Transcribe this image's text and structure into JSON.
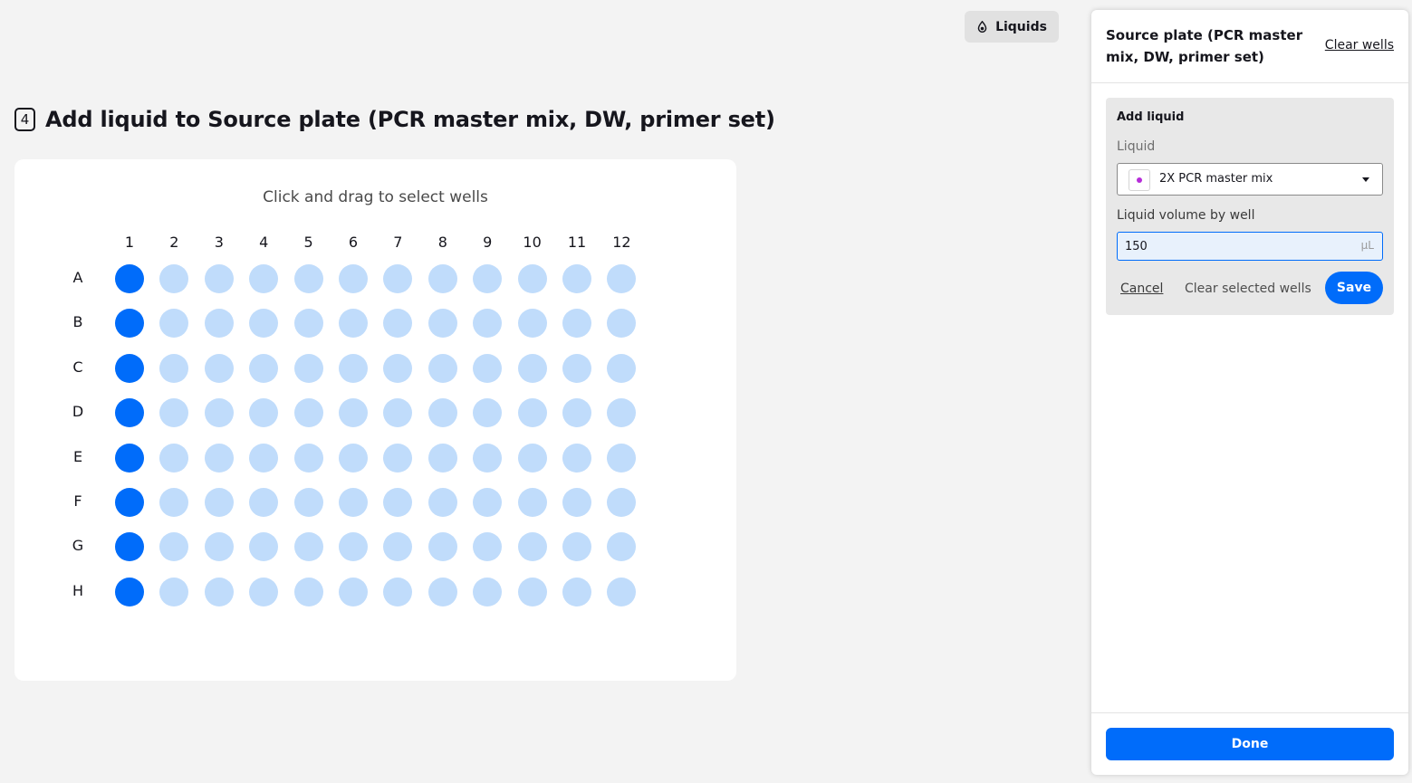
{
  "toolbar": {
    "liquids_label": "Liquids",
    "liquids_icon": "droplet-icon"
  },
  "step": {
    "number": "4",
    "title": "Add liquid to Source plate (PCR master mix, DW, primer set)"
  },
  "plate": {
    "instructions": "Click and drag to select wells",
    "columns": [
      "1",
      "2",
      "3",
      "4",
      "5",
      "6",
      "7",
      "8",
      "9",
      "10",
      "11",
      "12"
    ],
    "rows": [
      "A",
      "B",
      "C",
      "D",
      "E",
      "F",
      "G",
      "H"
    ],
    "selected_columns": [
      "1"
    ],
    "colors": {
      "selected": "#006cfa",
      "unselected": "#c0dcfb"
    }
  },
  "panel": {
    "title": "Source plate (PCR master mix, DW, primer set)",
    "clear_wells_label": "Clear wells",
    "add_liquid": {
      "heading": "Add liquid",
      "liquid_label": "Liquid",
      "liquid_value": "2X PCR master mix",
      "liquid_color": "#b62cd9",
      "volume_label": "Liquid volume by well",
      "volume_value": "150",
      "volume_unit": "µL",
      "cancel_label": "Cancel",
      "clear_selected_label": "Clear selected wells",
      "save_label": "Save"
    },
    "done_label": "Done"
  }
}
